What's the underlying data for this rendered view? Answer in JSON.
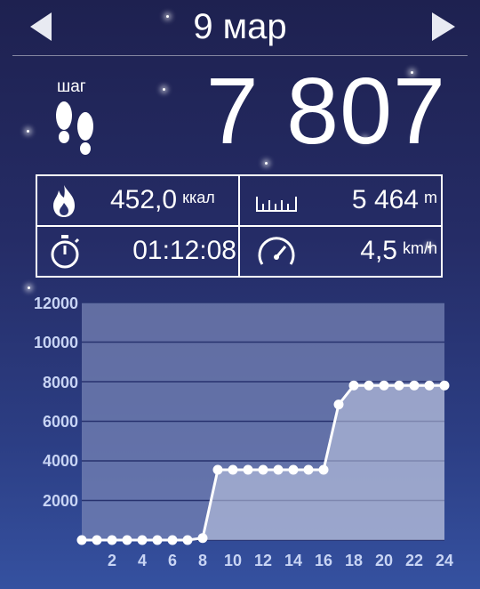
{
  "header": {
    "date": "9 мар"
  },
  "steps": {
    "label": "шаг",
    "value": "7 807"
  },
  "stats": {
    "calories": {
      "value": "452,0",
      "unit": "ккал"
    },
    "distance": {
      "value": "5 464",
      "unit": "m"
    },
    "duration": {
      "value": "01:12:08"
    },
    "speed": {
      "value": "4,5",
      "unit": "km/h"
    }
  },
  "chart_data": {
    "type": "area",
    "title": "",
    "xlabel": "",
    "ylabel": "",
    "ylim": [
      0,
      12000
    ],
    "xlim": [
      0,
      24
    ],
    "y_ticks": [
      "2000",
      "4000",
      "6000",
      "8000",
      "10000",
      "12000"
    ],
    "x_ticks": [
      "2",
      "4",
      "6",
      "8",
      "10",
      "12",
      "14",
      "16",
      "18",
      "20",
      "22",
      "24"
    ],
    "grid": true,
    "x": [
      0,
      1,
      2,
      3,
      4,
      5,
      6,
      7,
      8,
      9,
      10,
      11,
      12,
      13,
      14,
      15,
      16,
      17,
      18,
      19,
      20,
      21,
      22,
      23,
      24
    ],
    "values": [
      0,
      0,
      0,
      0,
      0,
      0,
      0,
      0,
      100,
      3550,
      3550,
      3550,
      3550,
      3550,
      3550,
      3550,
      3550,
      6850,
      7807,
      7807,
      7807,
      7807,
      7807,
      7807,
      7807
    ]
  }
}
